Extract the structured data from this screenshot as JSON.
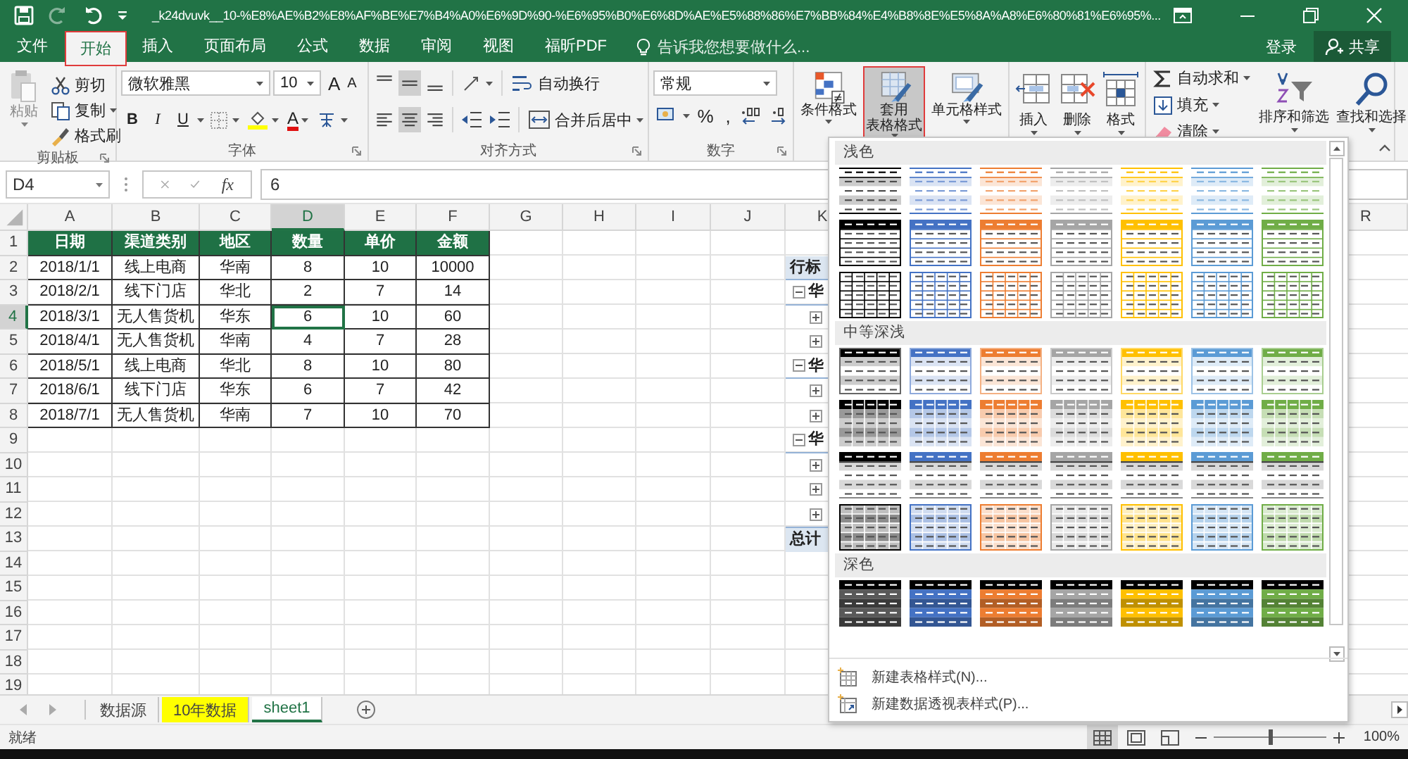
{
  "title_bar": {
    "quick_access": [
      {
        "kind": "save",
        "disabled": false
      },
      {
        "kind": "redo",
        "disabled": true
      },
      {
        "kind": "undo",
        "disabled": false
      }
    ],
    "title": "_k24dvuvk__10-%E8%AE%B2%E8%AF%BE%E7%B4%A0%E6%9D%90-%E6%95%B0%E6%8D%AE%E5%88%86%E7%BB%84%E4%B8%8E%E5%8A%A8%E6%80%81%E6%95%..."
  },
  "tabs": [
    {
      "label": "文件",
      "selected": false,
      "highlighted": false
    },
    {
      "label": "开始",
      "selected": true,
      "highlighted": true
    },
    {
      "label": "插入",
      "selected": false,
      "highlighted": false
    },
    {
      "label": "页面布局",
      "selected": false,
      "highlighted": false
    },
    {
      "label": "公式",
      "selected": false,
      "highlighted": false
    },
    {
      "label": "数据",
      "selected": false,
      "highlighted": false
    },
    {
      "label": "审阅",
      "selected": false,
      "highlighted": false
    },
    {
      "label": "视图",
      "selected": false,
      "highlighted": false
    },
    {
      "label": "福昕PDF",
      "selected": false,
      "highlighted": false
    }
  ],
  "tell_me": "告诉我您想要做什么...",
  "sign_in": "登录",
  "share": "共享",
  "ribbon": {
    "groups": [
      {
        "kind": "clipboard",
        "label": "剪贴板",
        "paste": {
          "label": "粘贴",
          "disabled": true
        },
        "commands": [
          "剪切",
          "复制",
          "格式刷"
        ]
      },
      {
        "kind": "font",
        "label": "字体",
        "font_name": "微软雅黑",
        "font_size": "10",
        "grow": "A",
        "shrink": "A",
        "styles": [
          "B",
          "I",
          "U"
        ],
        "font_color": "A"
      },
      {
        "kind": "alignment",
        "label": "对齐方式",
        "vertical": [
          {
            "selected": false
          },
          {
            "selected": true
          },
          {
            "selected": false
          }
        ],
        "horizontal": [
          {
            "selected": false
          },
          {
            "selected": true
          },
          {
            "selected": false
          }
        ],
        "wrap": "自动换行",
        "merge": "合并后居中"
      },
      {
        "kind": "number",
        "label": "数字",
        "format": "常规",
        "percent": "%",
        "comma": ","
      },
      {
        "kind": "styles",
        "buttons": [
          {
            "lines": [
              "条件格式"
            ],
            "selected": false,
            "highlighted": false
          },
          {
            "lines": [
              "套用",
              "表格格式"
            ],
            "selected": true,
            "highlighted": true
          },
          {
            "lines": [
              "单元格样式"
            ],
            "selected": false,
            "highlighted": false
          }
        ]
      },
      {
        "kind": "cells",
        "buttons": [
          "插入",
          "删除",
          "格式"
        ]
      },
      {
        "kind": "editing",
        "commands": [
          "自动求和",
          "填充",
          "清除"
        ],
        "buttons": [
          "排序和筛选",
          "查找和选择"
        ]
      }
    ]
  },
  "formula_bar": {
    "name_box": "D4",
    "function_button": "fx",
    "value": "6"
  },
  "sheet": {
    "columns": [
      {
        "label": "A",
        "selected": false
      },
      {
        "label": "B",
        "selected": false
      },
      {
        "label": "C",
        "selected": false
      },
      {
        "label": "D",
        "selected": true
      },
      {
        "label": "E",
        "selected": false
      },
      {
        "label": "F",
        "selected": false
      },
      {
        "label": "G",
        "selected": false
      },
      {
        "label": "H",
        "selected": false
      },
      {
        "label": "I",
        "selected": false
      },
      {
        "label": "J",
        "selected": false
      },
      {
        "label": "K",
        "selected": false
      },
      {
        "label": "R",
        "selected": false
      }
    ],
    "rows": [
      {
        "label": "1",
        "selected": false
      },
      {
        "label": "2",
        "selected": false
      },
      {
        "label": "3",
        "selected": false
      },
      {
        "label": "4",
        "selected": true
      },
      {
        "label": "5",
        "selected": false
      },
      {
        "label": "6",
        "selected": false
      },
      {
        "label": "7",
        "selected": false
      },
      {
        "label": "8",
        "selected": false
      },
      {
        "label": "9",
        "selected": false
      },
      {
        "label": "10",
        "selected": false
      },
      {
        "label": "11",
        "selected": false
      },
      {
        "label": "12",
        "selected": false
      },
      {
        "label": "13",
        "selected": false
      },
      {
        "label": "14",
        "selected": false
      },
      {
        "label": "15",
        "selected": false
      },
      {
        "label": "16",
        "selected": false
      },
      {
        "label": "17",
        "selected": false
      },
      {
        "label": "18",
        "selected": false
      },
      {
        "label": "19",
        "selected": false
      }
    ],
    "table": {
      "header": [
        "日期",
        "渠道类别",
        "地区",
        "数量",
        "单价",
        "金额"
      ],
      "rows": [
        [
          "2018/1/1",
          "线上电商",
          "华南",
          "8",
          "10",
          "10000"
        ],
        [
          "2018/2/1",
          "线下门店",
          "华北",
          "2",
          "7",
          "14"
        ],
        [
          "2018/3/1",
          "无人售货机",
          "华东",
          "6",
          "10",
          "60"
        ],
        [
          "2018/4/1",
          "无人售货机",
          "华南",
          "4",
          "7",
          "28"
        ],
        [
          "2018/5/1",
          "线上电商",
          "华北",
          "8",
          "10",
          "80"
        ],
        [
          "2018/6/1",
          "线下门店",
          "华东",
          "6",
          "7",
          "42"
        ],
        [
          "2018/7/1",
          "无人售货机",
          "华南",
          "7",
          "10",
          "70"
        ]
      ]
    },
    "pivot": [
      {
        "kind": "header",
        "text": "行标"
      },
      {
        "kind": "group",
        "text": "华"
      },
      {
        "kind": "item"
      },
      {
        "kind": "item"
      },
      {
        "kind": "group",
        "text": "华"
      },
      {
        "kind": "item"
      },
      {
        "kind": "item"
      },
      {
        "kind": "group",
        "text": "华"
      },
      {
        "kind": "item"
      },
      {
        "kind": "item"
      },
      {
        "kind": "item"
      },
      {
        "kind": "total",
        "text": "总计"
      }
    ]
  },
  "gallery": {
    "sections": [
      {
        "title": "浅色",
        "rows": [
          {
            "kind": "light-banded",
            "styles": [
              {
                "color": "#000000"
              },
              {
                "color": "#4472c4"
              },
              {
                "color": "#ed7d31"
              },
              {
                "color": "#a5a5a5"
              },
              {
                "color": "#ffc000"
              },
              {
                "color": "#5b9bd5"
              },
              {
                "color": "#70ad47"
              }
            ]
          },
          {
            "kind": "light-header",
            "styles": [
              {
                "color": "#000000"
              },
              {
                "color": "#4472c4"
              },
              {
                "color": "#ed7d31"
              },
              {
                "color": "#a5a5a5"
              },
              {
                "color": "#ffc000"
              },
              {
                "color": "#5b9bd5"
              },
              {
                "color": "#70ad47"
              }
            ]
          },
          {
            "kind": "light-grid",
            "styles": [
              {
                "color": "#000000"
              },
              {
                "color": "#4472c4"
              },
              {
                "color": "#ed7d31"
              },
              {
                "color": "#a5a5a5"
              },
              {
                "color": "#ffc000"
              },
              {
                "color": "#5b9bd5"
              },
              {
                "color": "#70ad47"
              }
            ]
          }
        ]
      },
      {
        "title": "中等深浅",
        "rows": [
          {
            "kind": "medium-banded",
            "styles": [
              {
                "color": "#000000"
              },
              {
                "color": "#4472c4"
              },
              {
                "color": "#ed7d31"
              },
              {
                "color": "#a5a5a5"
              },
              {
                "color": "#ffc000"
              },
              {
                "color": "#5b9bd5"
              },
              {
                "color": "#70ad47"
              }
            ]
          },
          {
            "kind": "medium-tinted",
            "styles": [
              {
                "color": "#000000"
              },
              {
                "color": "#4472c4"
              },
              {
                "color": "#ed7d31"
              },
              {
                "color": "#a5a5a5"
              },
              {
                "color": "#ffc000"
              },
              {
                "color": "#5b9bd5"
              },
              {
                "color": "#70ad47"
              }
            ]
          },
          {
            "kind": "medium-topbar",
            "styles": [
              {
                "color": "#000000"
              },
              {
                "color": "#4472c4"
              },
              {
                "color": "#ed7d31"
              },
              {
                "color": "#a5a5a5"
              },
              {
                "color": "#ffc000"
              },
              {
                "color": "#5b9bd5"
              },
              {
                "color": "#70ad47"
              }
            ]
          },
          {
            "kind": "medium-grid",
            "styles": [
              {
                "color": "#000000"
              },
              {
                "color": "#4472c4"
              },
              {
                "color": "#ed7d31"
              },
              {
                "color": "#a5a5a5"
              },
              {
                "color": "#ffc000"
              },
              {
                "color": "#5b9bd5"
              },
              {
                "color": "#70ad47"
              }
            ]
          }
        ]
      },
      {
        "title": "深色",
        "rows": [
          {
            "kind": "dark",
            "styles": [
              {
                "color": "#000000"
              },
              {
                "color": "#4472c4"
              },
              {
                "color": "#ed7d31"
              },
              {
                "color": "#a5a5a5"
              },
              {
                "color": "#ffc000"
              },
              {
                "color": "#5b9bd5"
              },
              {
                "color": "#70ad47"
              }
            ]
          }
        ]
      }
    ],
    "footer": [
      {
        "kind": "table",
        "label": "新建表格样式(N)..."
      },
      {
        "kind": "pivot",
        "label": "新建数据透视表样式(P)..."
      }
    ]
  },
  "sheet_tabs": [
    {
      "label": "数据源",
      "selected": false
    },
    {
      "label": "10年数据",
      "selected": false,
      "color": "#ffff00"
    },
    {
      "label": "sheet1",
      "selected": true
    }
  ],
  "status_bar": {
    "status": "就绪",
    "views": [
      {
        "kind": "normal",
        "selected": true
      },
      {
        "kind": "page-layout",
        "selected": false
      },
      {
        "kind": "page-break",
        "selected": false
      }
    ],
    "zoom": {
      "level": 0.5,
      "value": "100%"
    }
  }
}
